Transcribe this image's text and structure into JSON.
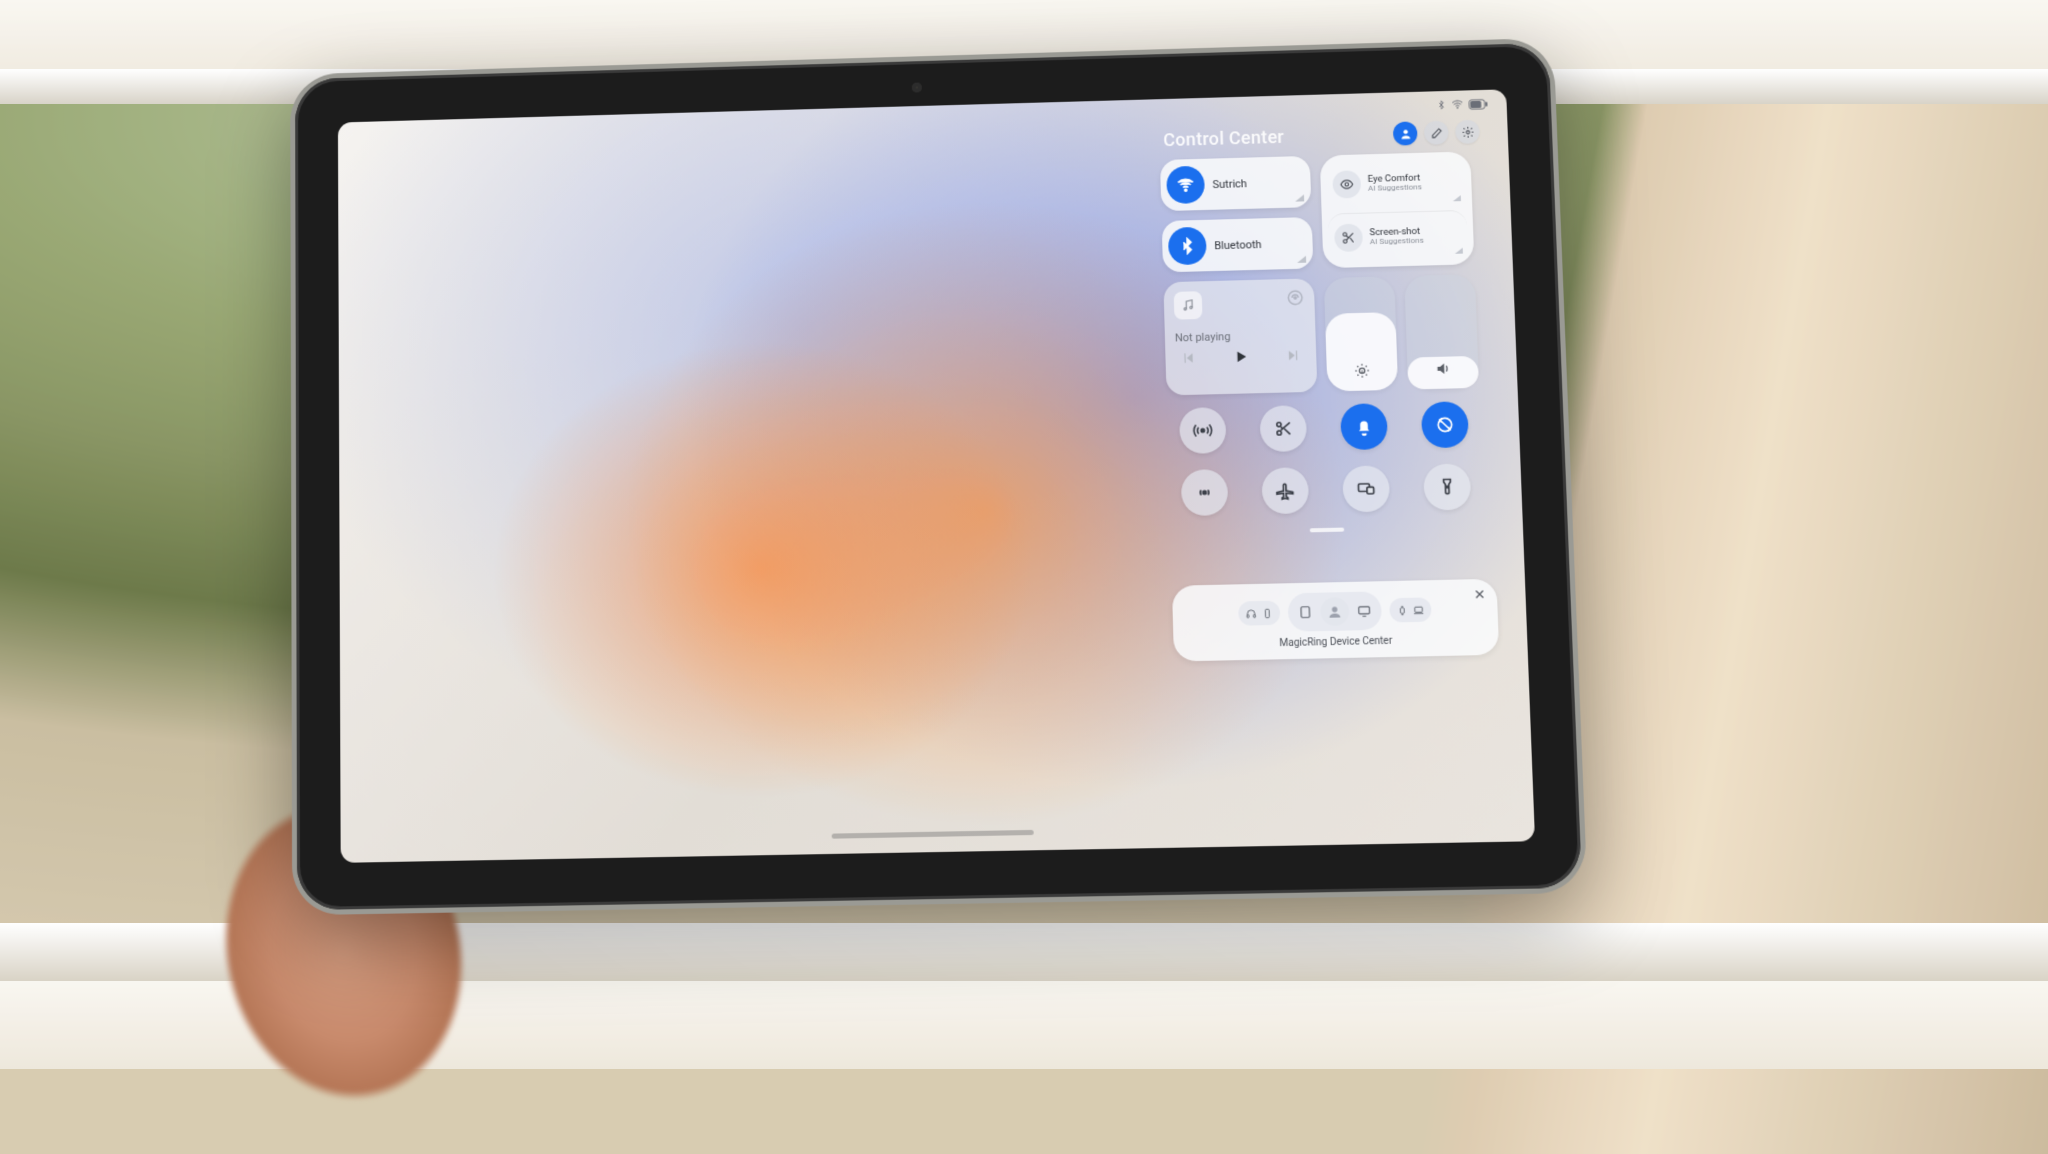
{
  "header": {
    "title": "Control Center"
  },
  "wifi": {
    "label": "Sutrich"
  },
  "bluetooth": {
    "label": "Bluetooth"
  },
  "suggestions": {
    "eye": {
      "title": "Eye Comfort",
      "sub": "AI Suggestions"
    },
    "shot": {
      "title": "Screen-shot",
      "sub": "AI Suggestions"
    }
  },
  "media": {
    "status": "Not playing"
  },
  "device_center": {
    "caption": "MagicRing Device Center"
  }
}
